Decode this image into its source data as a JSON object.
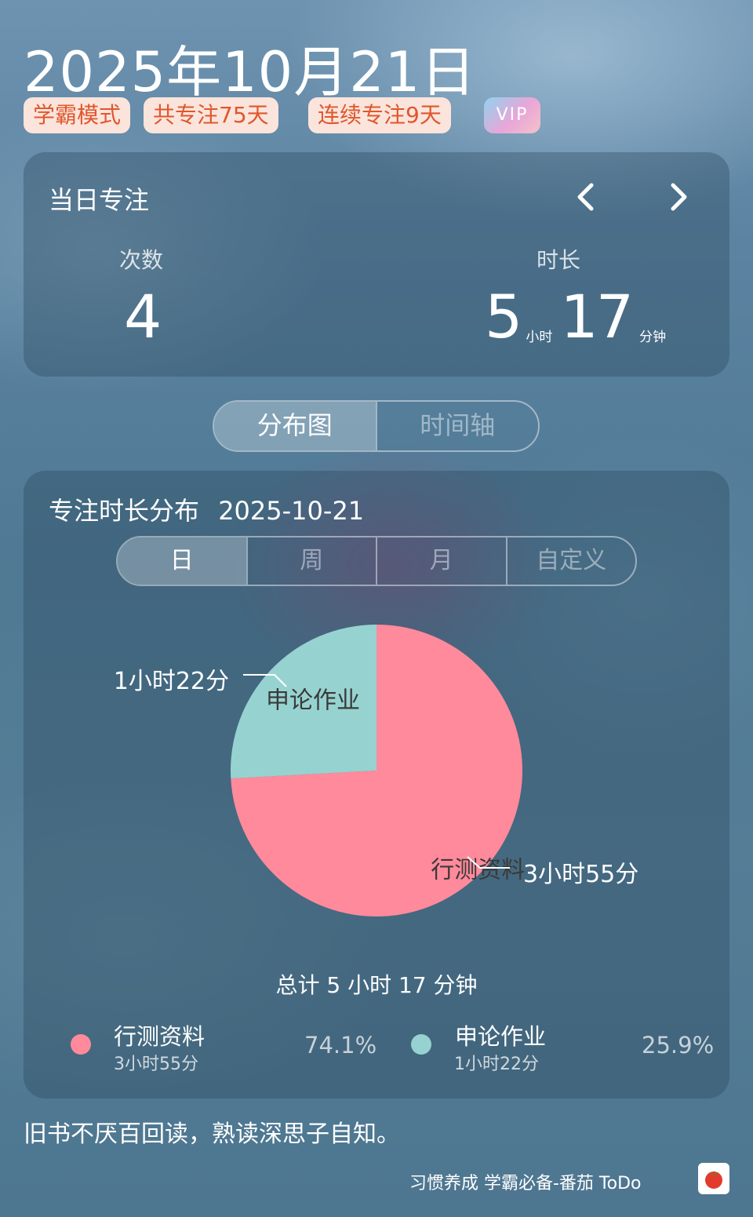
{
  "header": {
    "date": "2025年10月21日",
    "tags": [
      "学霸模式",
      "共专注75天",
      "连续专注9天"
    ],
    "vip": "VIP"
  },
  "daily": {
    "title": "当日专注",
    "count_label": "次数",
    "count_value": "4",
    "duration_label": "时长",
    "hours": "5",
    "hours_unit": "小时",
    "minutes": "17",
    "minutes_unit": "分钟"
  },
  "view_tabs": [
    "分布图",
    "时间轴"
  ],
  "distribution": {
    "title": "专注时长分布",
    "date": "2025-10-21",
    "range_tabs": [
      "日",
      "周",
      "月",
      "自定义"
    ],
    "total": "总计 5 小时 17 分钟"
  },
  "chart_data": {
    "type": "pie",
    "slices": [
      {
        "name": "行测资料",
        "label": "3小时55分",
        "minutes": 235,
        "percent": "74.1%",
        "color": "#ff8a9b"
      },
      {
        "name": "申论作业",
        "label": "1小时22分",
        "minutes": 82,
        "percent": "25.9%",
        "color": "#96d3d0"
      }
    ]
  },
  "quote": "旧书不厌百回读，熟读深思子自知。",
  "footer": "习惯养成 学霸必备-番茄 ToDo",
  "icons": [
    "chevron-left-icon",
    "chevron-right-icon",
    "tomato-icon"
  ]
}
